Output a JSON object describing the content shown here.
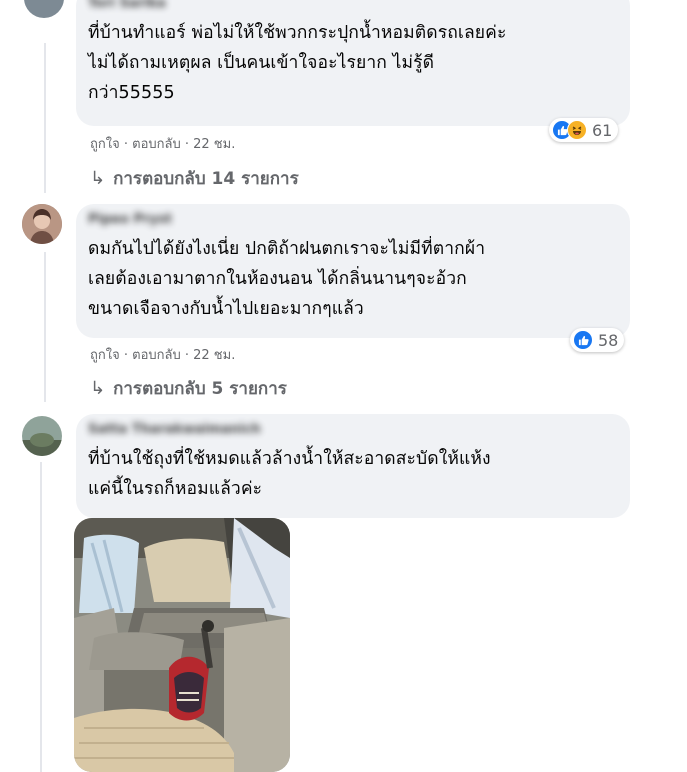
{
  "comments": [
    {
      "author": "Tori Sarika",
      "lines": [
        "ที่บ้านทำแอร์ พ่อไม่ให้ใช้พวกกระปุกน้ำหอมติดรถเลยค่ะ",
        "ไม่ได้ถามเหตุผล เป็นคนเข้าใจอะไรยาก ไม่รู้ดี",
        "กว่า55555"
      ],
      "like_label": "ถูกใจ",
      "reply_label": "ตอบกลับ",
      "time": "22 ชม.",
      "reaction_count": "61",
      "replies_label": "การตอบกลับ 14 รายการ"
    },
    {
      "author": "Pipeo Pryst",
      "lines": [
        "ดมกันไปได้ยังไงเนี่ย ปกติถ้าฝนตกเราจะไม่มีที่ตากผ้า",
        "เลยต้องเอามาตากในห้องนอน ได้กลิ่นนานๆจะอ้วก",
        "ขนาดเจือจางกับน้ำไปเยอะมากๆแล้ว"
      ],
      "like_label": "ถูกใจ",
      "reply_label": "ตอบกลับ",
      "time": "22 ชม.",
      "reaction_count": "58",
      "replies_label": "การตอบกลับ 5 รายการ"
    },
    {
      "author": "Satta Tharakwaimanich",
      "lines": [
        "ที่บ้านใช้ถุงที่ใช้หมดแล้วล้างน้ำให้สะอาดสะบัดให้แห้ง",
        "แค่นี้ในรถก็หอมแล้วค่ะ"
      ]
    }
  ],
  "separator": "·",
  "reply_arrow": "↳",
  "colors": {
    "bubble": "#f0f2f5",
    "meta_text": "#65676b",
    "like_blue": "#1877f2",
    "haha_yellow": "#f7b125"
  },
  "icons": [
    "like-reaction-icon",
    "haha-reaction-icon",
    "reply-arrow-icon"
  ]
}
